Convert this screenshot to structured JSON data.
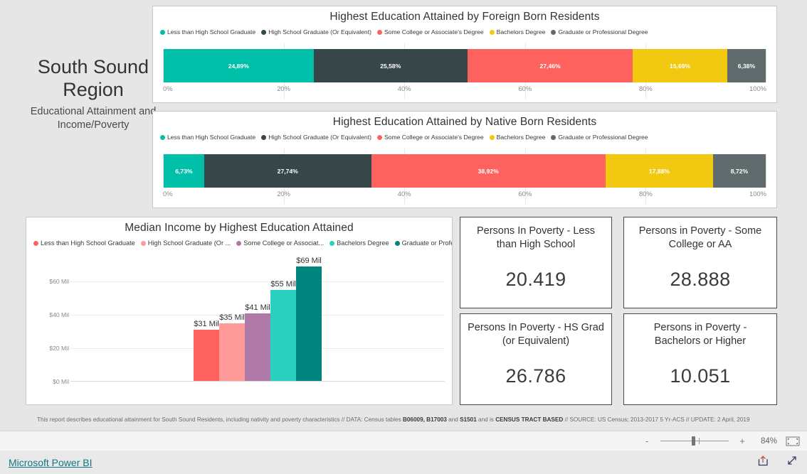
{
  "report": {
    "title_main": "South Sound Region",
    "title_sub": "Educational Attainment and Income/Poverty"
  },
  "colors": {
    "teal": "#00bfa9",
    "dark_slate": "#374649",
    "salmon": "#fd625e",
    "yellow": "#f2c811",
    "gray": "#5f6b6d",
    "bar_red": "#fd625e",
    "bar_pink": "#fe9a98",
    "bar_purple": "#b07aa8",
    "bar_teal": "#2bd1c0",
    "bar_dark_teal": "#00847e",
    "link_teal": "#11777f"
  },
  "chart_data": [
    {
      "type": "bar",
      "orientation": "horizontal-stacked-100",
      "title": "Highest Education Attained by Foreign Born Residents",
      "xlabel": "",
      "ylabel": "",
      "xlim": [
        0,
        100
      ],
      "grid": true,
      "legend_position": "top",
      "tick_labels": [
        "0%",
        "20%",
        "40%",
        "60%",
        "80%",
        "100%"
      ],
      "categories": [
        "Less than High School Graduate",
        "High School Graduate (Or Equivalent)",
        "Some College or Associate's Degree",
        "Bachelors Degree",
        "Graduate or Professional Degree"
      ],
      "values": [
        24.89,
        25.58,
        27.46,
        15.69,
        6.38
      ],
      "data_labels": [
        "24,89%",
        "25,58%",
        "27,46%",
        "15,69%",
        "6,38%"
      ],
      "colors": [
        "#00bfa9",
        "#374649",
        "#fd625e",
        "#f2c811",
        "#5f6b6d"
      ]
    },
    {
      "type": "bar",
      "orientation": "horizontal-stacked-100",
      "title": "Highest Education Attained by Native Born Residents",
      "xlabel": "",
      "ylabel": "",
      "xlim": [
        0,
        100
      ],
      "grid": true,
      "legend_position": "top",
      "tick_labels": [
        "0%",
        "20%",
        "40%",
        "60%",
        "80%",
        "100%"
      ],
      "categories": [
        "Less than High School Graduate",
        "High School Graduate (Or Equivalent)",
        "Some College or Associate's Degree",
        "Bachelors Degree",
        "Graduate or Professional Degree"
      ],
      "values": [
        6.73,
        27.74,
        38.92,
        17.88,
        8.72
      ],
      "data_labels": [
        "6,73%",
        "27,74%",
        "38,92%",
        "17,88%",
        "8,72%"
      ],
      "colors": [
        "#00bfa9",
        "#374649",
        "#fd625e",
        "#f2c811",
        "#5f6b6d"
      ]
    },
    {
      "type": "bar",
      "orientation": "vertical",
      "title": "Median Income by Highest Education Attained",
      "xlabel": "",
      "ylabel": "",
      "ylim": [
        0,
        72
      ],
      "grid": true,
      "legend_position": "top",
      "y_tick_labels": [
        "$0 Mil",
        "$20 Mil",
        "$40 Mil",
        "$60 Mil"
      ],
      "y_tick_values": [
        0,
        20,
        40,
        60
      ],
      "legend_labels": [
        "Less than High School Graduate",
        "High School Graduate (Or ...",
        "Some College or Associat...",
        "Bachelors Degree",
        "Graduate or Professio..."
      ],
      "categories": [
        "Less than High School Graduate",
        "High School Graduate (Or Equivalent)",
        "Some College or Associate's Degree",
        "Bachelors Degree",
        "Graduate or Professional Degree"
      ],
      "values": [
        31,
        35,
        41,
        55,
        69
      ],
      "data_labels": [
        "$31 Mil",
        "$35 Mil",
        "$41 Mil",
        "$55 Mil",
        "$69 Mil"
      ],
      "colors": [
        "#fd625e",
        "#fe9a98",
        "#b07aa8",
        "#2bd1c0",
        "#00847e"
      ]
    }
  ],
  "kpis": [
    {
      "title": "Persons In Poverty - Less than High School",
      "value": "20.419"
    },
    {
      "title": "Persons in Poverty - Some College or AA",
      "value": "28.888"
    },
    {
      "title": "Persons In Poverty - HS Grad (or Equivalent)",
      "value": "26.786"
    },
    {
      "title": "Persons in Poverty - Bachelors or Higher",
      "value": "10.051"
    }
  ],
  "footer": {
    "part1": "This report describes educational attainment for South Sound Residents, including nativity and poverty characteristics // DATA: Census tables ",
    "tables1": "B06009, B17003",
    "part2": " and ",
    "tables2": "S1501",
    "part3": " and is ",
    "emphasis": "CENSUS TRACT BASED",
    "part4": " // SOURCE: US Census; 2013-2017 5 Yr-ACS // UPDATE: 2 April, 2019"
  },
  "zoom_bar": {
    "minus_label": "-",
    "plus_label": "+",
    "percent": "84%"
  },
  "status_bar": {
    "link_label": "Microsoft Power BI"
  }
}
